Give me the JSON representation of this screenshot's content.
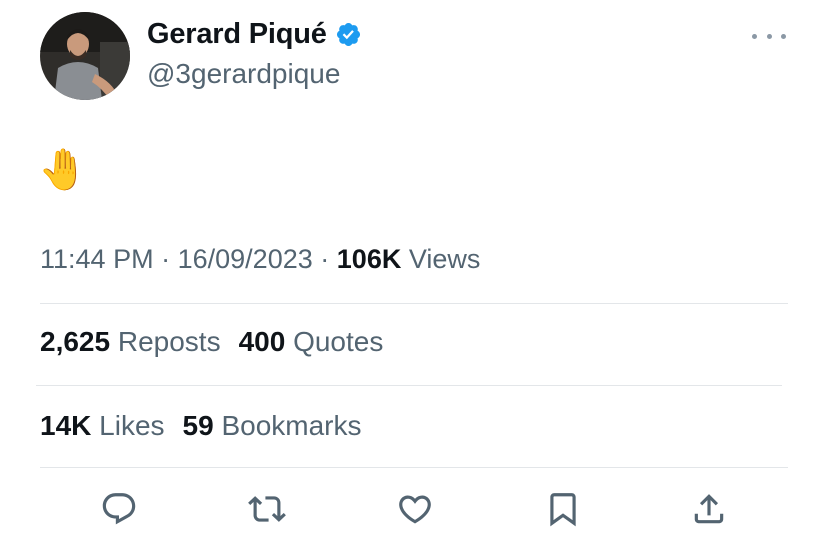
{
  "author": {
    "display_name": "Gerard Piqué",
    "handle": "@3gerardpique",
    "verified": true
  },
  "tweet": {
    "text": "🤚"
  },
  "meta": {
    "time": "11:44 PM",
    "separator": "·",
    "date": "16/09/2023",
    "views_count": "106K",
    "views_label": "Views"
  },
  "stats_row_1": [
    {
      "count": "2,625",
      "label": "Reposts"
    },
    {
      "count": "400",
      "label": "Quotes"
    }
  ],
  "stats_row_2": [
    {
      "count": "14K",
      "label": "Likes"
    },
    {
      "count": "59",
      "label": "Bookmarks"
    }
  ],
  "actions": [
    "reply-icon",
    "repost-icon",
    "like-icon",
    "bookmark-icon",
    "share-icon"
  ],
  "colors": {
    "text_primary": "#0f1419",
    "text_secondary": "#536471",
    "verified_blue": "#1d9bf0",
    "icon": "#536471",
    "divider": "#e3e6e9"
  }
}
